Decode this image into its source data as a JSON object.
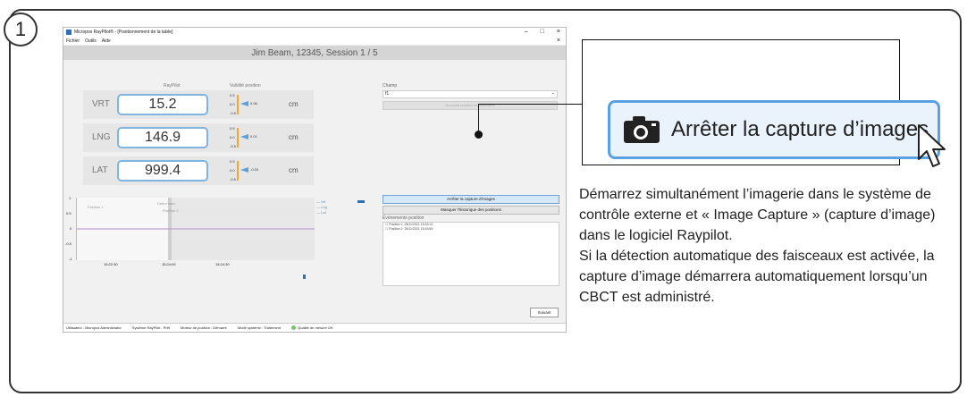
{
  "step": {
    "number": "1"
  },
  "app": {
    "title": "Micropos RayPilot® - [Positionnement de la table]",
    "menu": [
      "Fichier",
      "Outils",
      "Aide"
    ],
    "session": "Jim Beam, 12345, Session 1 / 5",
    "headers": {
      "raypilot": "RayPilot",
      "validity": "Validité position"
    },
    "measurements": [
      {
        "label": "VRT",
        "value": "15.2",
        "unit": "cm",
        "ticks": [
          "0.5",
          "0.0",
          "-0.5"
        ],
        "indicator": "0.06"
      },
      {
        "label": "LNG",
        "value": "146.9",
        "unit": "cm",
        "ticks": [
          "0.5",
          "0.0",
          "-0.5"
        ],
        "indicator": "0.01"
      },
      {
        "label": "LAT",
        "value": "999.4",
        "unit": "cm",
        "ticks": [
          "0.5",
          "0.0",
          "-0.5"
        ],
        "indicator": "-0.03"
      }
    ],
    "chart": {
      "yticks": [
        "1",
        "0.5",
        "0",
        "-0.5",
        "-1"
      ],
      "xticks": [
        "15:22:30",
        "15:24:00",
        "15:24:30"
      ],
      "labels": [
        "Position 1",
        "Début faisc.",
        "Position 2"
      ],
      "legend": [
        "Vrt",
        "Lng",
        "Lat"
      ]
    },
    "field": {
      "label": "Champ",
      "value": "f1",
      "replay_button": "Nouvelle position de traitement"
    },
    "capture_button": "Arrêter la capture d'images",
    "history_button": "Masquer l'historique des positions",
    "events": {
      "label": "Événements position",
      "items": [
        "Position 1: 25/11/2021 15:33:12",
        "Position 2: 25/11/2021 15:33:59"
      ]
    },
    "next_button": "Suivant",
    "status": {
      "user": "Utilisateur : Micropos Administrator",
      "system": "Système RayPilot : Prêt",
      "position_engine": "Moteur de position : Démarré",
      "mode": "Mode système : Traitement",
      "quality": "Qualité de mesure OK"
    }
  },
  "callout": {
    "button_label": "Arrêter la capture d’images",
    "icon": "camera-icon"
  },
  "description": {
    "p1": "Démarrez simultanément l’imagerie dans le système de contrôle externe et « Image Capture » (capture d’image) dans le logiciel Raypilot.",
    "p2": "Si la détection automatique des faisceaux est activée, la capture d’image démarrera automatiquement lorsqu’un CBCT est administré."
  },
  "colors": {
    "accent_blue": "#59a1e1",
    "indicator_orange": "#f0a92c",
    "quality_green": "#7bc46b"
  }
}
